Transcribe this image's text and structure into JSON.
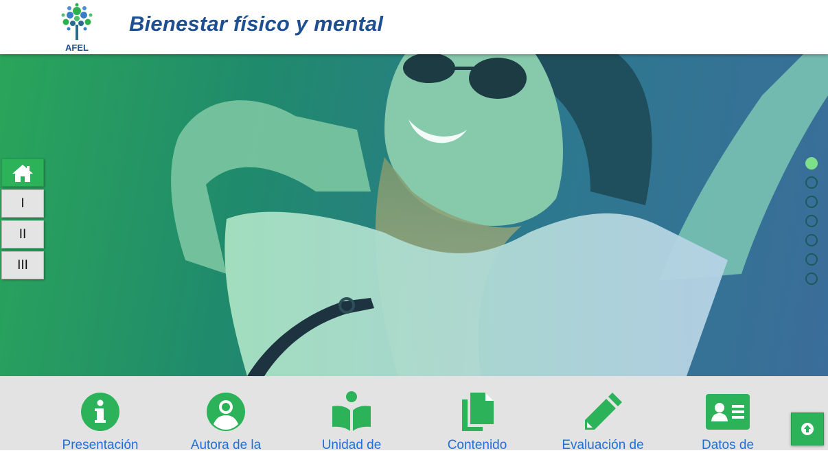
{
  "header": {
    "logo_text": "AFEL",
    "title": "Bienestar físico y mental"
  },
  "side_nav": {
    "home_icon": "home-icon",
    "items": [
      {
        "label": "I"
      },
      {
        "label": "II"
      },
      {
        "label": "III"
      }
    ]
  },
  "slider": {
    "dot_count": 7,
    "active_index": 0
  },
  "menu": {
    "items": [
      {
        "label": "Presentación",
        "icon": "info-circle-icon"
      },
      {
        "label": "Autora de la",
        "icon": "user-circle-icon"
      },
      {
        "label": "Unidad de",
        "icon": "book-reader-icon"
      },
      {
        "label": "Contenido",
        "icon": "documents-icon"
      },
      {
        "label": "Evaluación de",
        "icon": "pencil-icon"
      },
      {
        "label": "Datos de",
        "icon": "id-card-icon"
      }
    ]
  },
  "colors": {
    "brand_blue": "#1d4f91",
    "accent_green": "#2cb35a",
    "link_blue": "#1f6fd6",
    "menu_bg": "#e3e3e3"
  },
  "scroll_top_icon": "arrow-up-circle-icon"
}
